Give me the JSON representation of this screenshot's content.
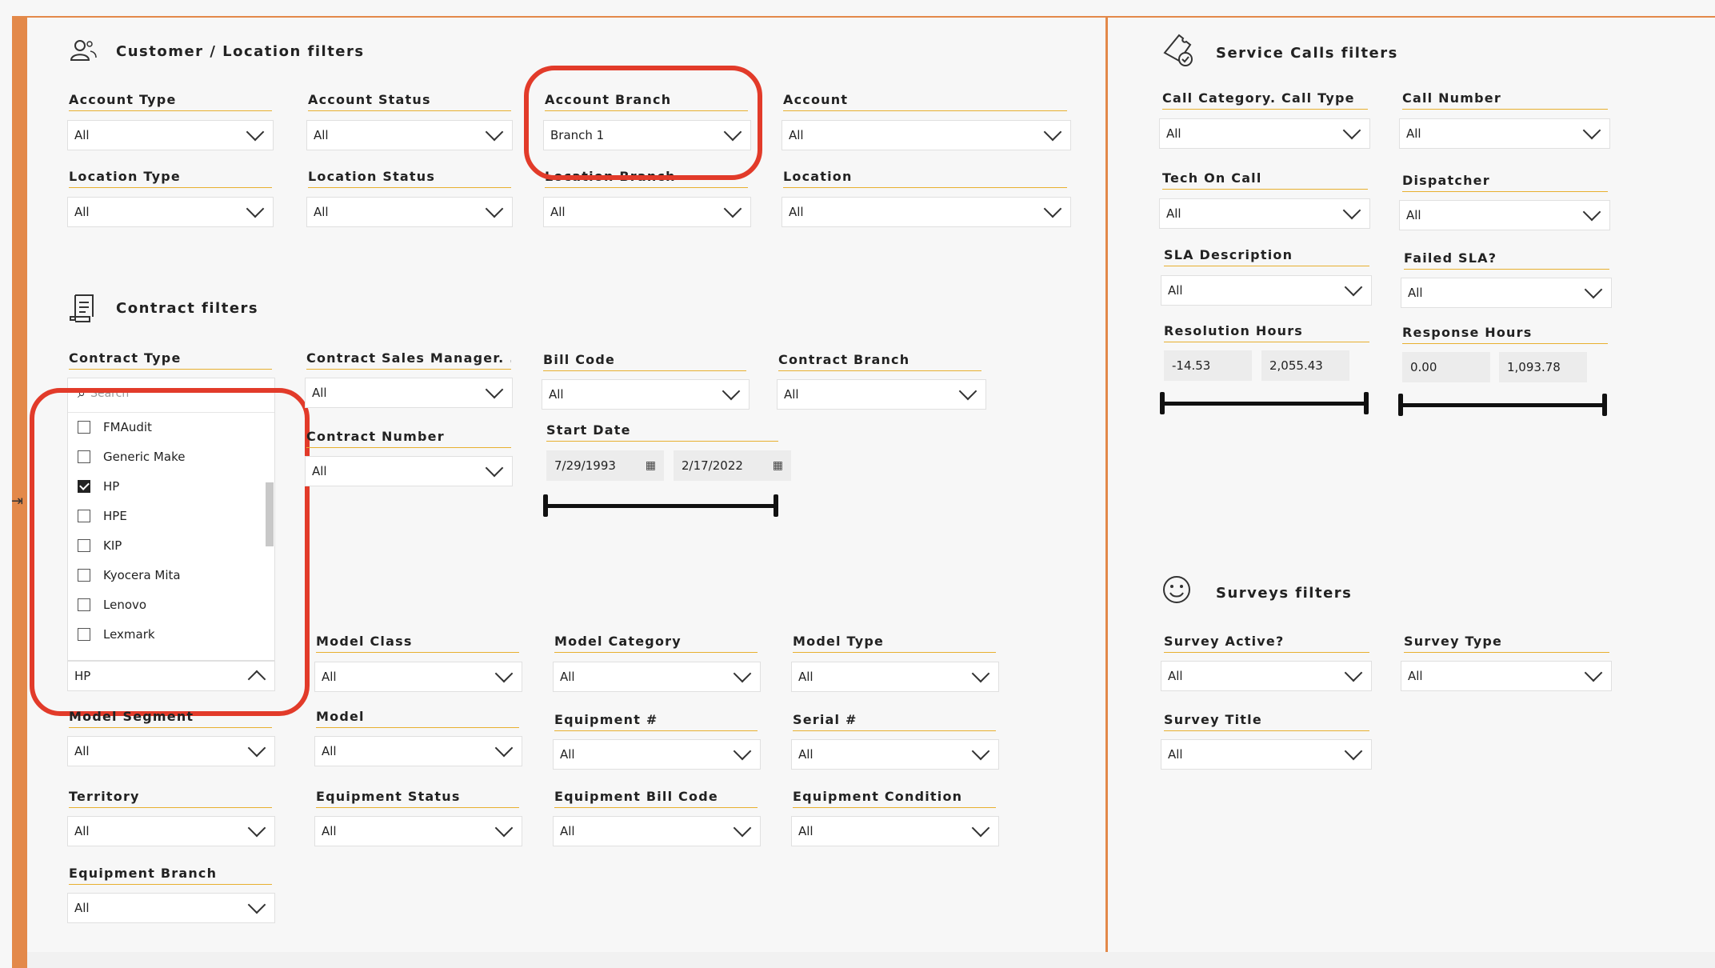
{
  "sections": {
    "customer": "Customer / Location filters",
    "contract": "Contract filters",
    "service": "Service Calls filters",
    "surveys": "Surveys filters"
  },
  "customer": {
    "account_type": {
      "label": "Account Type",
      "value": "All"
    },
    "account_status": {
      "label": "Account Status",
      "value": "All"
    },
    "account_branch": {
      "label": "Account Branch",
      "value": "Branch 1"
    },
    "account": {
      "label": "Account",
      "value": "All"
    },
    "location_type": {
      "label": "Location Type",
      "value": "All"
    },
    "location_status": {
      "label": "Location Status",
      "value": "All"
    },
    "location_branch": {
      "label": "Location Branch",
      "value": "All"
    },
    "location": {
      "label": "Location",
      "value": "All"
    }
  },
  "contract": {
    "contract_type": {
      "label": "Contract Type",
      "search_placeholder": "Search",
      "items": [
        {
          "label": "FMAudit",
          "checked": false
        },
        {
          "label": "Generic Make",
          "checked": false
        },
        {
          "label": "HP",
          "checked": true
        },
        {
          "label": "HPE",
          "checked": false
        },
        {
          "label": "KIP",
          "checked": false
        },
        {
          "label": "Kyocera Mita",
          "checked": false
        },
        {
          "label": "Lenovo",
          "checked": false
        },
        {
          "label": "Lexmark",
          "checked": false
        }
      ],
      "selected": "HP"
    },
    "sales_manager": {
      "label": "Contract Sales Manager. ...",
      "value": "All"
    },
    "bill_code": {
      "label": "Bill Code",
      "value": "All"
    },
    "contract_branch": {
      "label": "Contract Branch",
      "value": "All"
    },
    "contract_number": {
      "label": "Contract Number",
      "value": "All"
    },
    "start_date": {
      "label": "Start Date",
      "from": "7/29/1993",
      "to": "2/17/2022"
    }
  },
  "equipment": {
    "model_class": {
      "label": "Model Class",
      "value": "All"
    },
    "model_category": {
      "label": "Model Category",
      "value": "All"
    },
    "model_type": {
      "label": "Model Type",
      "value": "All"
    },
    "model_segment": {
      "label": "Model Segment",
      "value": "All"
    },
    "model": {
      "label": "Model",
      "value": "All"
    },
    "equipment_num": {
      "label": "Equipment #",
      "value": "All"
    },
    "serial_num": {
      "label": "Serial #",
      "value": "All"
    },
    "territory": {
      "label": "Territory",
      "value": "All"
    },
    "equipment_status": {
      "label": "Equipment Status",
      "value": "All"
    },
    "equipment_bill_code": {
      "label": "Equipment Bill Code",
      "value": "All"
    },
    "equipment_condition": {
      "label": "Equipment Condition",
      "value": "All"
    },
    "equipment_branch": {
      "label": "Equipment Branch",
      "value": "All"
    }
  },
  "service": {
    "call_category": {
      "label": "Call Category. Call Type",
      "value": "All"
    },
    "call_number": {
      "label": "Call Number",
      "value": "All"
    },
    "tech_on_call": {
      "label": "Tech On Call",
      "value": "All"
    },
    "dispatcher": {
      "label": "Dispatcher",
      "value": "All"
    },
    "sla_description": {
      "label": "SLA Description",
      "value": "All"
    },
    "failed_sla": {
      "label": "Failed SLA?",
      "value": "All"
    },
    "resolution_hours": {
      "label": "Resolution Hours",
      "min": "-14.53",
      "max": "2,055.43"
    },
    "response_hours": {
      "label": "Response Hours",
      "min": "0.00",
      "max": "1,093.78"
    }
  },
  "surveys": {
    "survey_active": {
      "label": "Survey Active?",
      "value": "All"
    },
    "survey_type": {
      "label": "Survey Type",
      "value": "All"
    },
    "survey_title": {
      "label": "Survey Title",
      "value": "All"
    }
  },
  "colors": {
    "accent": "#e3894a",
    "underline": "#e8b030",
    "highlight": "#e23b2a"
  }
}
